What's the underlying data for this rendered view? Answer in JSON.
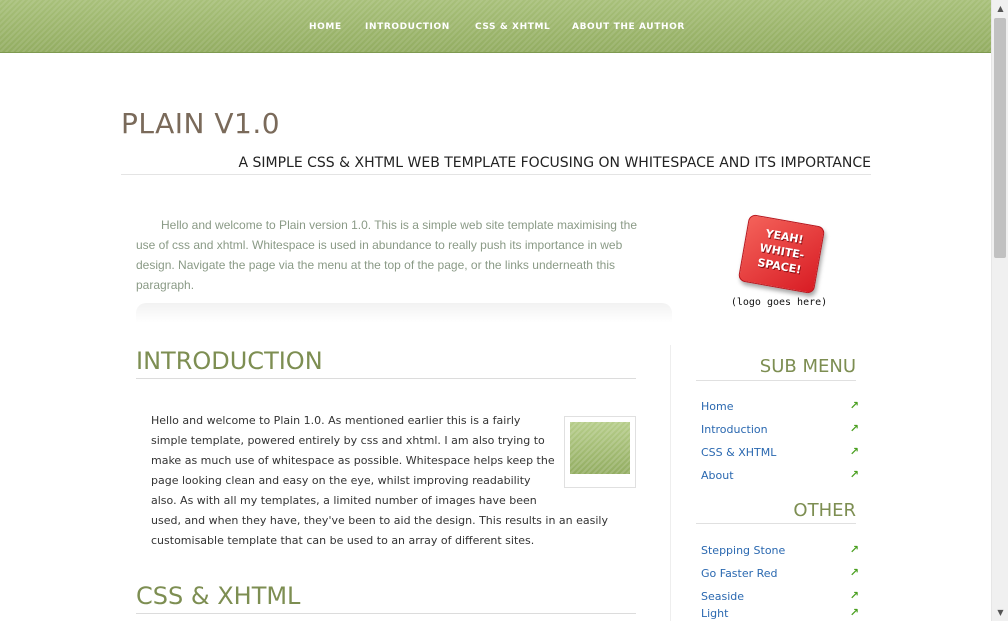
{
  "nav": {
    "items": [
      "HOME",
      "INTRODUCTION",
      "CSS & XHTML",
      "ABOUT THE AUTHOR"
    ]
  },
  "header": {
    "title": "PLAIN V1.0",
    "tagline": "A SIMPLE CSS & XHTML WEB TEMPLATE FOCUSING ON WHITESPACE AND ITS IMPORTANCE"
  },
  "intro": {
    "text": "Hello and welcome to Plain version 1.0. This is a simple web site template maximising the use of css and xhtml. Whitespace is used in abundance to really push its importance in web design. Navigate the page via the menu at the top of the page, or the links underneath this paragraph."
  },
  "logo": {
    "badge_text": "YEAH!\nWHITE-\nSPACE!",
    "caption": "(logo goes here)"
  },
  "main": {
    "sections": [
      {
        "heading": "INTRODUCTION",
        "lines": [
          "Hello and welcome to Plain 1.0. As mentioned earlier this is a fairly",
          "simple template, powered entirely by css and xhtml. I am also trying to",
          "make as much use of whitespace as possible. Whitespace helps keep the",
          "page looking clean and easy on the eye, whilst improving readability",
          "also. As with all my templates, a limited number of images have been",
          "used, and when they have, they've been to aid the design. This results in an easily",
          "customisable template that can be used to an array of different sites."
        ]
      },
      {
        "heading": "CSS & XHTML"
      }
    ]
  },
  "sidebar": {
    "sub_menu": {
      "heading": "SUB MENU",
      "links": [
        "Home",
        "Introduction",
        "CSS & XHTML",
        "About"
      ]
    },
    "other": {
      "heading": "OTHER",
      "links": [
        "Stepping Stone",
        "Go Faster Red",
        "Seaside",
        "Light"
      ]
    },
    "arrow_icon": "arrow-up-right-icon"
  },
  "colors": {
    "nav_bar": "#9cb56b",
    "heading_green": "#7d8e52",
    "link_blue": "#2a68b0",
    "arrow_green": "#4aa020",
    "logo_red": "#e23a3a"
  }
}
